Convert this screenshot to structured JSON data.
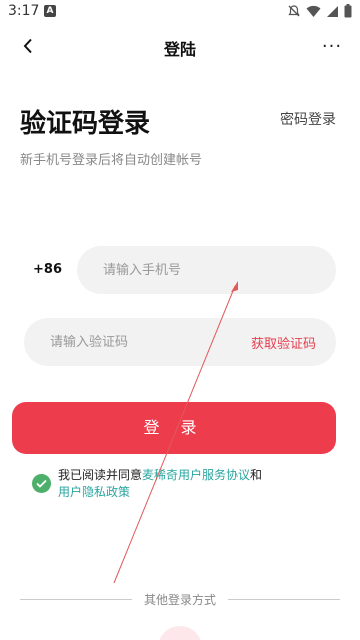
{
  "status_bar": {
    "time": "3:17",
    "notice_badge": "A"
  },
  "nav": {
    "title": "登陆",
    "more": "···"
  },
  "header": {
    "title": "验证码登录",
    "alt_login": "密码登录",
    "subtitle": "新手机号登录后将自动创建帐号"
  },
  "phone": {
    "country_code": "+86",
    "placeholder": "请输入手机号"
  },
  "code": {
    "placeholder": "请输入验证码",
    "get_code": "获取验证码"
  },
  "login_button": "登 录",
  "agreement": {
    "prefix": "我已阅读并同意",
    "service_link": "麦稀奇用户服务协议",
    "conjunction": "和",
    "privacy_link": "用户隐私政策",
    "checked": true
  },
  "other_login": {
    "label": "其他登录方式"
  },
  "colors": {
    "accent": "#ed3c4c",
    "link": "#2aa5a0",
    "check": "#4caf6a"
  }
}
